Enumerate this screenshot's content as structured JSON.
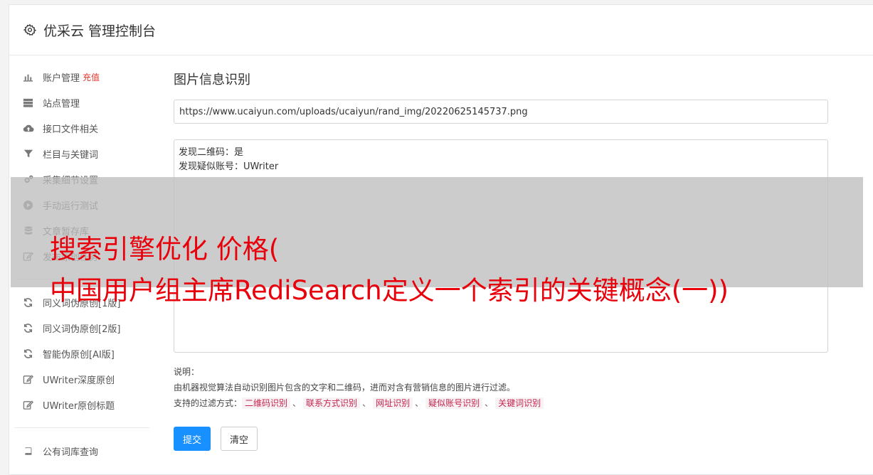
{
  "header": {
    "title": "优采云 管理控制台",
    "icon": "gear-icon"
  },
  "sidebar": {
    "group1": [
      {
        "label": "账户管理",
        "badge": "充值",
        "icon": "bar-chart-icon"
      },
      {
        "label": "站点管理",
        "icon": "server-icon"
      },
      {
        "label": "接口文件相关",
        "icon": "cloud-upload-icon"
      },
      {
        "label": "栏目与关键词",
        "icon": "filter-icon"
      },
      {
        "label": "采集细节设置",
        "icon": "gears-icon"
      },
      {
        "label": "手动运行测试",
        "icon": "play-icon"
      },
      {
        "label": "文章暂存库",
        "icon": "database-icon"
      },
      {
        "label": "发布原创任务",
        "icon": "edit-icon"
      }
    ],
    "group2": [
      {
        "label": "同义词伪原创[1版]",
        "icon": "refresh-icon"
      },
      {
        "label": "同义词伪原创[2版]",
        "icon": "refresh-icon"
      },
      {
        "label": "智能伪原创[AI版]",
        "icon": "refresh-icon"
      },
      {
        "label": "UWriter深度原创",
        "icon": "edit-icon"
      },
      {
        "label": "UWriter原创标题",
        "icon": "edit-icon"
      }
    ],
    "group3": [
      {
        "label": "公有词库查询",
        "icon": "book-icon"
      }
    ]
  },
  "main": {
    "title": "图片信息识别",
    "url_value": "https://www.ucaiyun.com/uploads/ucaiyun/rand_img/20220625145737.png",
    "result_value": "发现二维码：是\n发现疑似账号：UWriter",
    "notes_heading": "说明：",
    "notes_desc": "由机器视觉算法自动识别图片包含的文字和二维码，进而对含有营销信息的图片进行过滤。",
    "notes_methods_label": "支持的过滤方式：",
    "methods": [
      "二维码识别",
      "联系方式识别",
      "网址识别",
      "疑似账号识别",
      "关键词识别"
    ],
    "method_sep": "、",
    "submit_label": "提交",
    "clear_label": "清空"
  },
  "overlay": {
    "line1": "搜索引擎优化 价格(",
    "line2": "中国用户组主席RediSearch定义一个索引的关键概念(一))"
  }
}
